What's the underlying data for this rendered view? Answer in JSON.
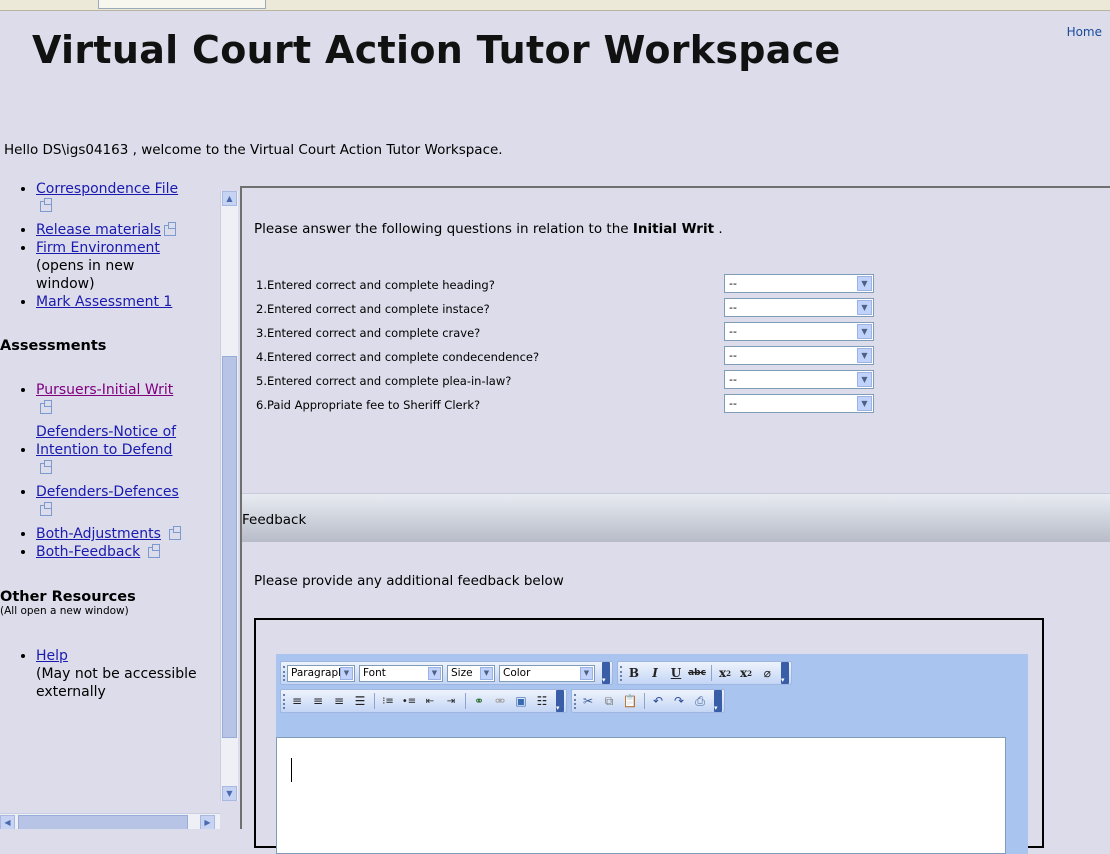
{
  "header": {
    "title": "Virtual Court Action Tutor Workspace",
    "home_link": "Home",
    "welcome": "Hello DS\\igs04163 , welcome to the Virtual Court Action Tutor Workspace."
  },
  "sidebar": {
    "top_items": [
      {
        "label": "Correspondence File"
      },
      {
        "label": "Release materials"
      },
      {
        "label": "Firm Environment",
        "note": "(opens in new window)"
      },
      {
        "label": "Mark Assessment 1"
      }
    ],
    "assessments_heading": "Assessments",
    "assessments": [
      {
        "label": "Pursuers-Initial Writ"
      },
      {
        "label": "Defenders-Notice of Intention to Defend"
      },
      {
        "label": "Defenders-Defences"
      },
      {
        "label": "Both-Adjustments"
      },
      {
        "label": "Both-Feedback"
      }
    ],
    "other_heading": "Other Resources",
    "other_subheading": "(All open a new window)",
    "other_items": [
      {
        "label": "Help",
        "note": "(May not be accessible externally"
      }
    ]
  },
  "main": {
    "intro_prefix": "Please answer the following questions in relation to the",
    "intro_bold": "Initial Writ",
    "intro_suffix": ".",
    "questions": [
      {
        "label": "1.Entered correct and complete heading?",
        "value": "--"
      },
      {
        "label": "2.Entered correct and complete instace?",
        "value": "--"
      },
      {
        "label": "3.Entered correct and complete crave?",
        "value": "--"
      },
      {
        "label": "4.Entered correct and complete condecendence?",
        "value": "--"
      },
      {
        "label": "5.Entered correct and complete plea-in-law?",
        "value": "--"
      },
      {
        "label": "6.Paid Appropriate fee to Sheriff Clerk?",
        "value": "--"
      }
    ],
    "feedback_heading": "Feedback",
    "feedback_instruction": "Please provide any additional feedback below"
  },
  "editor": {
    "paragraph": "Paragraph",
    "font": "Font",
    "size": "Size",
    "color": "Color",
    "icons_row1": [
      "bold-icon",
      "italic-icon",
      "underline-icon",
      "strikethrough-icon",
      "superscript-icon",
      "subscript-icon",
      "eraser-icon"
    ],
    "icons_row2": [
      "align-left-icon",
      "align-center-icon",
      "align-right-icon",
      "justify-icon",
      "ordered-list-icon",
      "unordered-list-icon",
      "outdent-icon",
      "indent-icon",
      "link-icon",
      "unlink-icon",
      "image-icon",
      "horizontal-rule-icon",
      "cut-icon",
      "copy-icon",
      "paste-icon",
      "undo-icon",
      "redo-icon",
      "print-icon"
    ]
  }
}
